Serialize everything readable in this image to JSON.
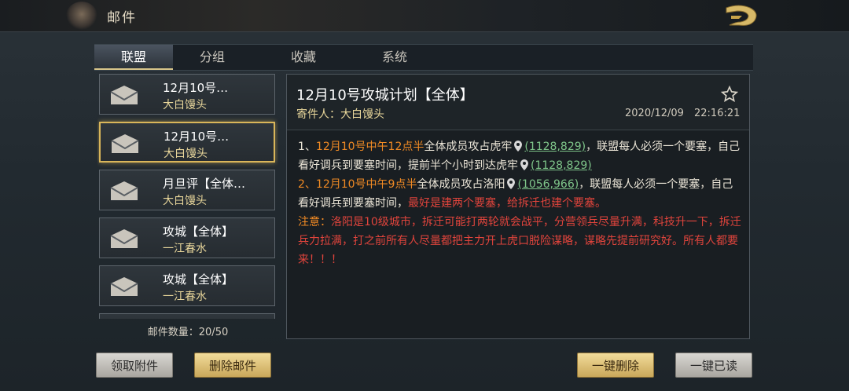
{
  "header": {
    "title": "邮件"
  },
  "tabs": [
    {
      "label": "联盟",
      "active": true
    },
    {
      "label": "分组",
      "active": false
    },
    {
      "label": "收藏",
      "active": false
    },
    {
      "label": "系统",
      "active": false
    }
  ],
  "mail_list": [
    {
      "subject": "12月10号…",
      "sender": "大白馒头",
      "selected": false
    },
    {
      "subject": "12月10号…",
      "sender": "大白馒头",
      "selected": true
    },
    {
      "subject": "月旦评【全体…",
      "sender": "大白馒头",
      "selected": false
    },
    {
      "subject": "攻城【全体】",
      "sender": "一江春水",
      "selected": false
    },
    {
      "subject": "攻城【全体】",
      "sender": "一江春水",
      "selected": false
    }
  ],
  "mail_count": "邮件数量：20/50",
  "detail": {
    "subject": "12月10号攻城计划【全体】",
    "from": "寄件人：大白馒头",
    "date": "2020/12/09",
    "time": "22:16:21",
    "line1_prefix": "1、",
    "line1_orange": "12月10号中午12点半",
    "line1_text": "全体成员攻占虎牢",
    "coord1": "(1128,829)",
    "line1_rest": "，联盟每人必须一个要塞，自己看好调兵到要塞时间，提前半个小时到达虎牢",
    "coord2": "(1128,829)",
    "line2_prefix": "2、",
    "line2_orange": "12月10号中午9点半",
    "line2_text": "全体成员攻占洛阳",
    "coord3": "(1056,966)",
    "line2_rest": "，联盟每人必须一个要塞，自己看好调兵到要塞时间，",
    "line2_red": "最好是建两个要塞，给拆迁也建个要塞。",
    "note_label": "注意：",
    "note_red": "洛阳是10级城市，拆迁可能打两轮就会战平，分营领兵尽量升满，科技升一下，拆迁兵力拉满，打之前所有人尽量都把主力开上虎口脱险谋略，谋略先提前研究好。所有人都要来！！！"
  },
  "buttons": {
    "claim": "领取附件",
    "delete": "删除邮件",
    "delete_all": "一键删除",
    "read_all": "一键已读"
  },
  "colors": {
    "accent_gold": "#d9b65a",
    "highlight_orange": "#f08a24",
    "alert_red": "#e0443c",
    "coord_green": "#7fc68a"
  }
}
